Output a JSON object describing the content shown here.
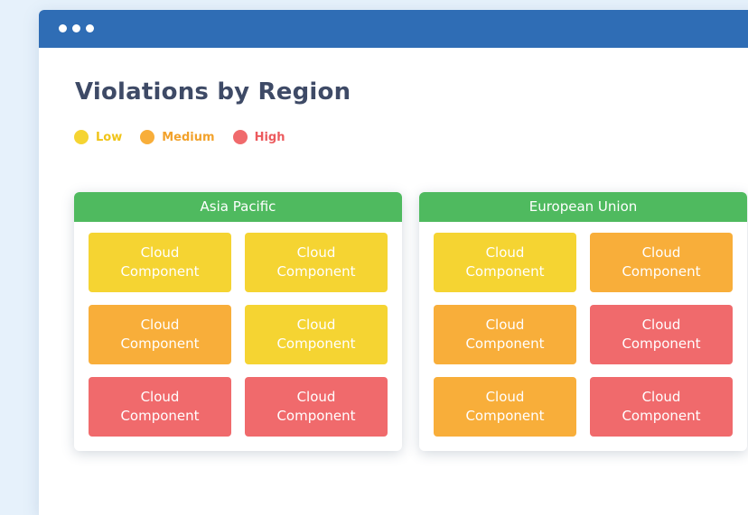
{
  "page": {
    "title": "Violations by Region"
  },
  "legend": [
    {
      "label": "Low",
      "level": "low",
      "color": "#f5d432",
      "text_color": "#f0c419"
    },
    {
      "label": "Medium",
      "level": "medium",
      "color": "#f8ae3a",
      "text_color": "#f2a22c"
    },
    {
      "label": "High",
      "level": "high",
      "color": "#f06a6c",
      "text_color": "#ec5a5d"
    }
  ],
  "colors": {
    "titlebar": "#2f6db5",
    "panel_header": "#4fba5f",
    "title_text": "#3e4a66",
    "low": "#f5d432",
    "medium": "#f8ae3a",
    "high": "#f06a6c"
  },
  "regions": [
    {
      "name": "Asia Pacific",
      "components": [
        {
          "line1": "Cloud",
          "line2": "Component",
          "level": "low"
        },
        {
          "line1": "Cloud",
          "line2": "Component",
          "level": "low"
        },
        {
          "line1": "Cloud",
          "line2": "Component",
          "level": "medium"
        },
        {
          "line1": "Cloud",
          "line2": "Component",
          "level": "low"
        },
        {
          "line1": "Cloud",
          "line2": "Component",
          "level": "high"
        },
        {
          "line1": "Cloud",
          "line2": "Component",
          "level": "high"
        }
      ]
    },
    {
      "name": "European Union",
      "components": [
        {
          "line1": "Cloud",
          "line2": "Component",
          "level": "low"
        },
        {
          "line1": "Cloud",
          "line2": "Component",
          "level": "medium"
        },
        {
          "line1": "Cloud",
          "line2": "Component",
          "level": "medium"
        },
        {
          "line1": "Cloud",
          "line2": "Component",
          "level": "high"
        },
        {
          "line1": "Cloud",
          "line2": "Component",
          "level": "medium"
        },
        {
          "line1": "Cloud",
          "line2": "Component",
          "level": "high"
        }
      ]
    }
  ]
}
